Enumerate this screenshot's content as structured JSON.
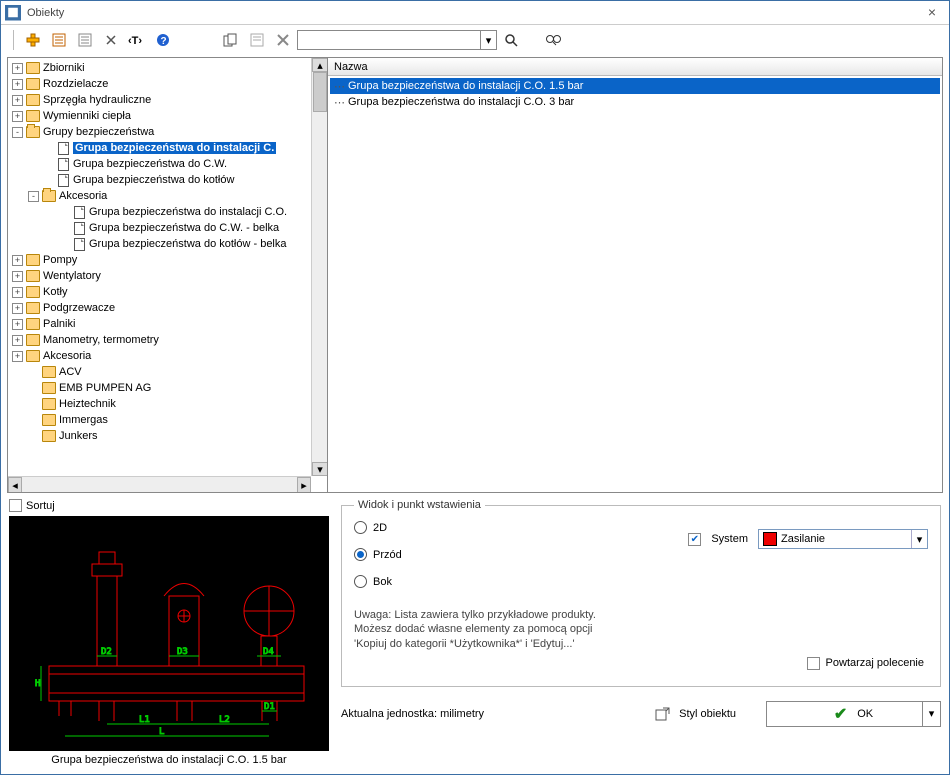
{
  "window": {
    "title": "Obiekty",
    "close": "×"
  },
  "toolbar": {
    "search_placeholder": ""
  },
  "tree": {
    "items": [
      {
        "t": "exp",
        "ind": 0,
        "sym": "+",
        "icon": "folder",
        "label": "Zbiorniki"
      },
      {
        "t": "exp",
        "ind": 0,
        "sym": "+",
        "icon": "folder",
        "label": "Rozdzielacze"
      },
      {
        "t": "exp",
        "ind": 0,
        "sym": "+",
        "icon": "folder",
        "label": "Sprzęgła hydrauliczne"
      },
      {
        "t": "exp",
        "ind": 0,
        "sym": "+",
        "icon": "folder",
        "label": "Wymienniki ciepła"
      },
      {
        "t": "exp",
        "ind": 0,
        "sym": "-",
        "icon": "folder-open",
        "label": "Grupy bezpieczeństwa"
      },
      {
        "t": "leaf",
        "ind": 2,
        "icon": "doc",
        "label": "Grupa bezpieczeństwa do instalacji C.",
        "sel": true
      },
      {
        "t": "leaf",
        "ind": 2,
        "icon": "doc",
        "label": "Grupa bezpieczeństwa do C.W."
      },
      {
        "t": "leaf",
        "ind": 2,
        "icon": "doc",
        "label": "Grupa bezpieczeństwa do kotłów"
      },
      {
        "t": "exp",
        "ind": 1,
        "sym": "-",
        "icon": "folder-open",
        "label": "Akcesoria"
      },
      {
        "t": "leaf",
        "ind": 3,
        "icon": "doc",
        "label": "Grupa bezpieczeństwa do instalacji C.O."
      },
      {
        "t": "leaf",
        "ind": 3,
        "icon": "doc",
        "label": "Grupa bezpieczeństwa do C.W. - belka"
      },
      {
        "t": "leaf",
        "ind": 3,
        "icon": "doc",
        "label": "Grupa bezpieczeństwa do kotłów - belka"
      },
      {
        "t": "exp",
        "ind": 0,
        "sym": "+",
        "icon": "folder",
        "label": "Pompy"
      },
      {
        "t": "exp",
        "ind": 0,
        "sym": "+",
        "icon": "folder",
        "label": "Wentylatory"
      },
      {
        "t": "exp",
        "ind": 0,
        "sym": "+",
        "icon": "folder",
        "label": "Kotły"
      },
      {
        "t": "exp",
        "ind": 0,
        "sym": "+",
        "icon": "folder",
        "label": "Podgrzewacze"
      },
      {
        "t": "exp",
        "ind": 0,
        "sym": "+",
        "icon": "folder",
        "label": "Palniki"
      },
      {
        "t": "exp",
        "ind": 0,
        "sym": "+",
        "icon": "folder",
        "label": "Manometry, termometry"
      },
      {
        "t": "exp",
        "ind": 0,
        "sym": "+",
        "icon": "folder",
        "label": "Akcesoria"
      },
      {
        "t": "leaf",
        "ind": 1,
        "icon": "folder",
        "label": "ACV"
      },
      {
        "t": "leaf",
        "ind": 1,
        "icon": "folder",
        "label": "EMB PUMPEN AG"
      },
      {
        "t": "leaf",
        "ind": 1,
        "icon": "folder",
        "label": "Heiztechnik"
      },
      {
        "t": "leaf",
        "ind": 1,
        "icon": "folder",
        "label": "Immergas"
      },
      {
        "t": "leaf",
        "ind": 1,
        "icon": "folder",
        "label": "Junkers"
      }
    ]
  },
  "list": {
    "header": "Nazwa",
    "rows": [
      {
        "label": "Grupa bezpieczeństwa do instalacji C.O. 1.5 bar",
        "sel": true
      },
      {
        "label": "Grupa bezpieczeństwa do instalacji C.O. 3 bar",
        "sel": false
      }
    ]
  },
  "sort_label": "Sortuj",
  "preview_caption": "Grupa bezpieczeństwa do instalacji C.O. 1.5 bar",
  "view": {
    "legend": "Widok i punkt wstawienia",
    "opt_2d": "2D",
    "opt_front": "Przód",
    "opt_side": "Bok",
    "system_label": "System",
    "system_value": "Zasilanie",
    "note1": "Uwaga: Lista zawiera tylko przykładowe produkty.",
    "note2": "Możesz dodać własne elementy za pomocą opcji",
    "note3": "'Kopiuj do kategorii *Użytkownika*' i 'Edytuj...'"
  },
  "repeat_label": "Powtarzaj polecenie",
  "unit_label": "Aktualna jednostka: milimetry",
  "style_label": "Styl obiektu",
  "ok_label": "OK",
  "preview_dims": {
    "D2": "D2",
    "D3": "D3",
    "D4": "D4",
    "D1": "D1",
    "H": "H",
    "L1": "L1",
    "L2": "L2",
    "L": "L"
  }
}
